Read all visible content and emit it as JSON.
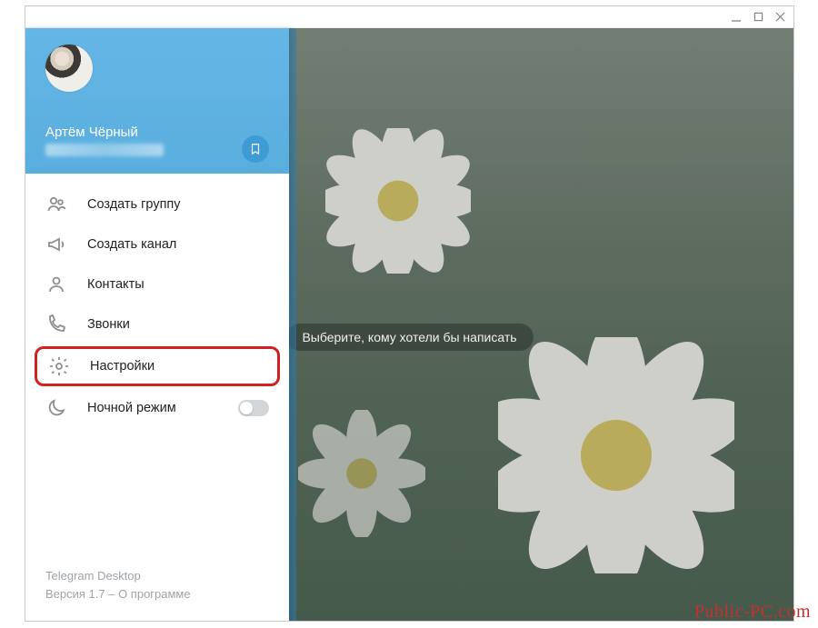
{
  "header": {
    "username": "Артём Чёрный"
  },
  "menu": {
    "new_group": "Создать группу",
    "new_channel": "Создать канал",
    "contacts": "Контакты",
    "calls": "Звонки",
    "settings": "Настройки",
    "night_mode": "Ночной режим"
  },
  "footer": {
    "app_name": "Telegram Desktop",
    "version_line": "Версия 1.7 – О программе"
  },
  "chat": {
    "placeholder_pill": "Выберите, кому хотели бы написать"
  },
  "watermark": "Public-PC.com"
}
